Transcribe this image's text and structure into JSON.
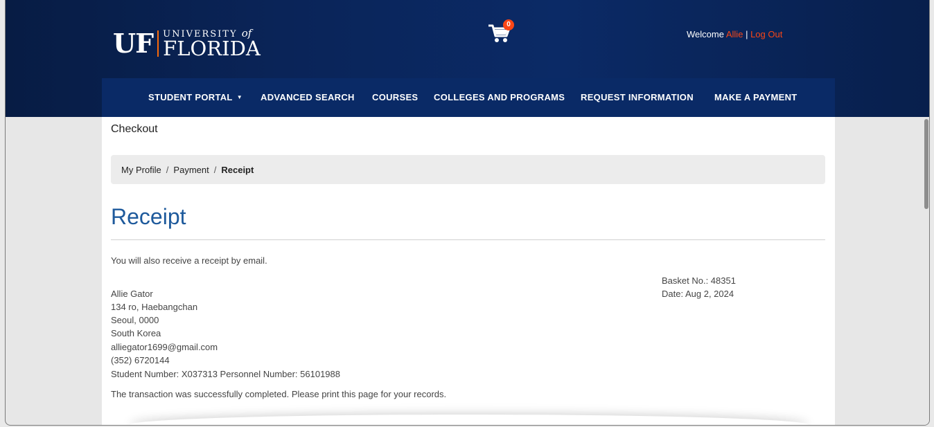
{
  "header": {
    "logo": {
      "uf": "UF",
      "university": "UNIVERSITY",
      "of": "of",
      "florida": "FLORIDA"
    },
    "cart_count": "0",
    "welcome_prefix": "Welcome",
    "user_name": "Allie",
    "separator": "|",
    "logout": "Log Out"
  },
  "nav": {
    "items": [
      {
        "label": "STUDENT PORTAL"
      },
      {
        "label": "ADVANCED SEARCH"
      },
      {
        "label": "COURSES"
      },
      {
        "label": "COLLEGES AND PROGRAMS"
      },
      {
        "label": "REQUEST INFORMATION"
      },
      {
        "label": "MAKE A PAYMENT"
      }
    ]
  },
  "page": {
    "section_title": "Checkout",
    "breadcrumb": {
      "items": [
        "My Profile",
        "Payment"
      ],
      "current": "Receipt"
    },
    "heading": "Receipt",
    "email_note": "You will also receive a receipt by email.",
    "basket": "Basket No.: 48351",
    "date": "Date: Aug 2, 2024",
    "address": [
      "Allie Gator",
      "134 ro, Haebangchan",
      "Seoul, 0000",
      "South Korea",
      "alliegator1699@gmail.com",
      "(352) 6720144",
      "Student Number: X037313 Personnel Number: 56101988"
    ],
    "success_message": "The transaction was successfully completed. Please print this page for your records."
  },
  "colors": {
    "header_bg": "#0b2a66",
    "accent_orange": "#fa4616",
    "heading_blue": "#1e5a9c"
  }
}
